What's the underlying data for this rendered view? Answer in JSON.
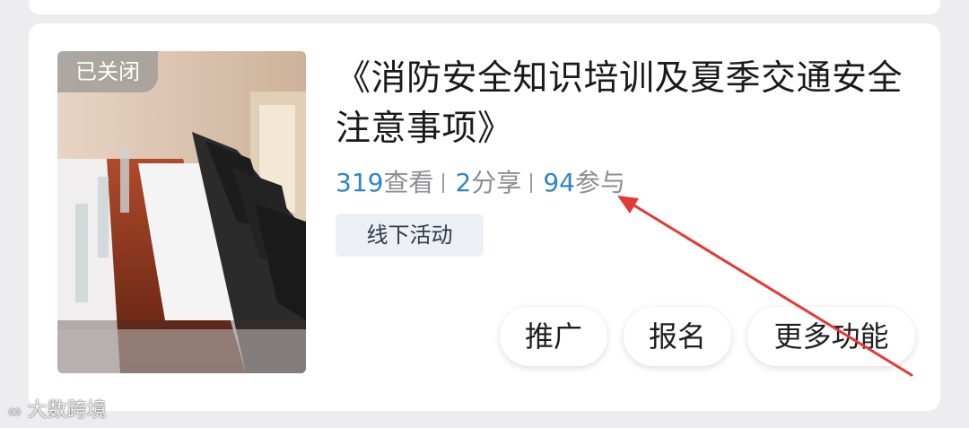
{
  "activity": {
    "status_badge": "已关闭",
    "title": "《消防安全知识培训及夏季交通安全注意事项》",
    "stats": {
      "views": {
        "value": "319",
        "label": "查看"
      },
      "shares": {
        "value": "2",
        "label": "分享"
      },
      "participants": {
        "value": "94",
        "label": "参与"
      }
    },
    "tag": "线下活动",
    "image_alt": "conference-room-photo"
  },
  "actions": {
    "promote": "推广",
    "signup": "报名",
    "more": "更多功能"
  },
  "annotation": {
    "color": "#e53935"
  },
  "watermark": {
    "text": "大数跨境"
  },
  "colors": {
    "accent": "#2f86c6",
    "muted": "#8e8e93",
    "background": "#ededf0"
  }
}
